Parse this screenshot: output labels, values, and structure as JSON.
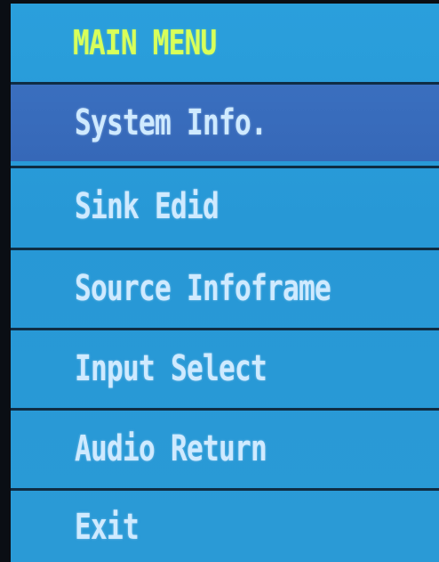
{
  "title": "MAIN MENU",
  "selected_index": 0,
  "items": [
    {
      "label": "System Info."
    },
    {
      "label": "Sink Edid"
    },
    {
      "label": "Source Infoframe"
    },
    {
      "label": "Input Select"
    },
    {
      "label": "Audio Return"
    },
    {
      "label": "Exit"
    }
  ],
  "colors": {
    "background": "#2a9ad6",
    "selected": "#3668b8",
    "title": "#d8ff5a",
    "text": "#cfeaff"
  }
}
